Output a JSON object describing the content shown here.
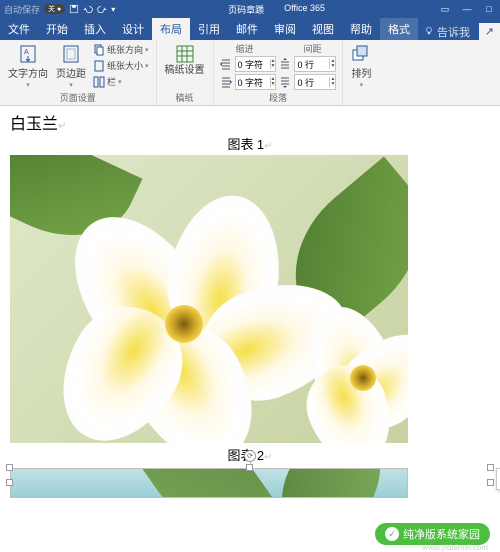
{
  "accent": "#2b579a",
  "titlebar": {
    "autosave": "自动保存",
    "autosave_state": "关",
    "doc_title": "页码章踬",
    "suite": "Office 365"
  },
  "tabs": {
    "file": "文件",
    "home": "开始",
    "insert": "插入",
    "design": "设计",
    "layout": "布局",
    "references": "引用",
    "mailings": "邮件",
    "review": "审阅",
    "view": "视图",
    "help": "帮助",
    "format": "格式",
    "tellme": "告诉我",
    "share_icon": "↗"
  },
  "ribbon": {
    "page_setup": {
      "text_direction": "文字方向",
      "margins": "页边距",
      "orientation": "纸张方向",
      "size": "纸张大小",
      "columns": "栏",
      "label": "页面设置"
    },
    "gaozhi": {
      "settings": "稿纸设置",
      "label": "稿纸"
    },
    "paragraph": {
      "indent_label": "缩进",
      "spacing_label": "间距",
      "indent_left": "0 字符",
      "indent_right": "0 字符",
      "space_before": "0 行",
      "space_after": "0 行",
      "label": "段落"
    },
    "arrange": {
      "arrange": "排列"
    }
  },
  "document": {
    "heading": "白玉兰",
    "caption1_label": "图表",
    "caption1_num": "1",
    "caption2_label": "图表",
    "caption2_num": "2"
  },
  "watermark": {
    "brand": "纯净版系统家园",
    "url": "www.yidaimei.com"
  }
}
